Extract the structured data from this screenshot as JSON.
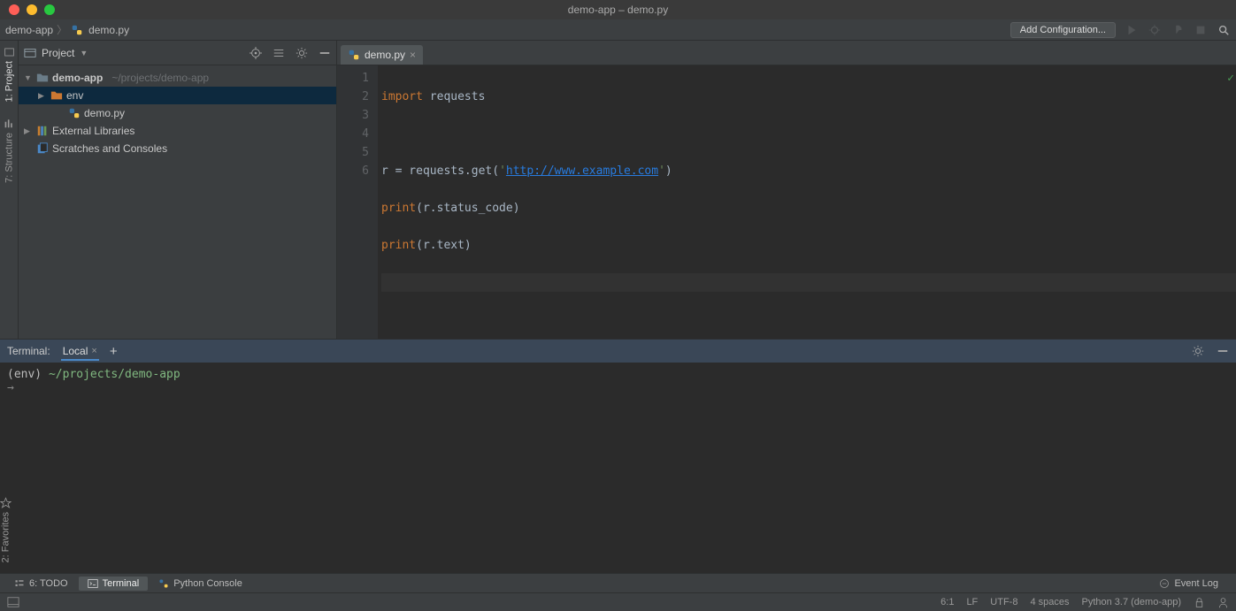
{
  "window": {
    "title": "demo-app – demo.py"
  },
  "breadcrumb": {
    "project": "demo-app",
    "file": "demo.py"
  },
  "toolbar": {
    "add_config": "Add Configuration..."
  },
  "left_rail": {
    "project": "1: Project",
    "structure": "7: Structure",
    "favorites": "2: Favorites"
  },
  "project_pane": {
    "title": "Project",
    "root": {
      "name": "demo-app",
      "path": "~/projects/demo-app"
    },
    "env": "env",
    "file": "demo.py",
    "ext_libs": "External Libraries",
    "scratches": "Scratches and Consoles"
  },
  "editor": {
    "tab": "demo.py",
    "lines": {
      "l1_kw": "import",
      "l1_rest": " requests",
      "l3_pre": "r = requests.get(",
      "l3_q1": "'",
      "l3_url": "http://www.example.com",
      "l3_q2": "'",
      "l3_post": ")",
      "l4_kw": "print",
      "l4_rest": "(r.status_code)",
      "l5_kw": "print",
      "l5_rest": "(r.text)"
    },
    "gutter": [
      "1",
      "2",
      "3",
      "4",
      "5",
      "6"
    ]
  },
  "terminal": {
    "label": "Terminal:",
    "tab": "Local",
    "line1_env": "(env) ",
    "line1_path": "~/projects/demo-app",
    "prompt": "→"
  },
  "bottom_tools": {
    "todo": "6: TODO",
    "terminal": "Terminal",
    "python_console": "Python Console",
    "event_log": "Event Log"
  },
  "status": {
    "pos": "6:1",
    "sep": "LF",
    "enc": "UTF-8",
    "indent": "4 spaces",
    "interp": "Python 3.7 (demo-app)"
  }
}
